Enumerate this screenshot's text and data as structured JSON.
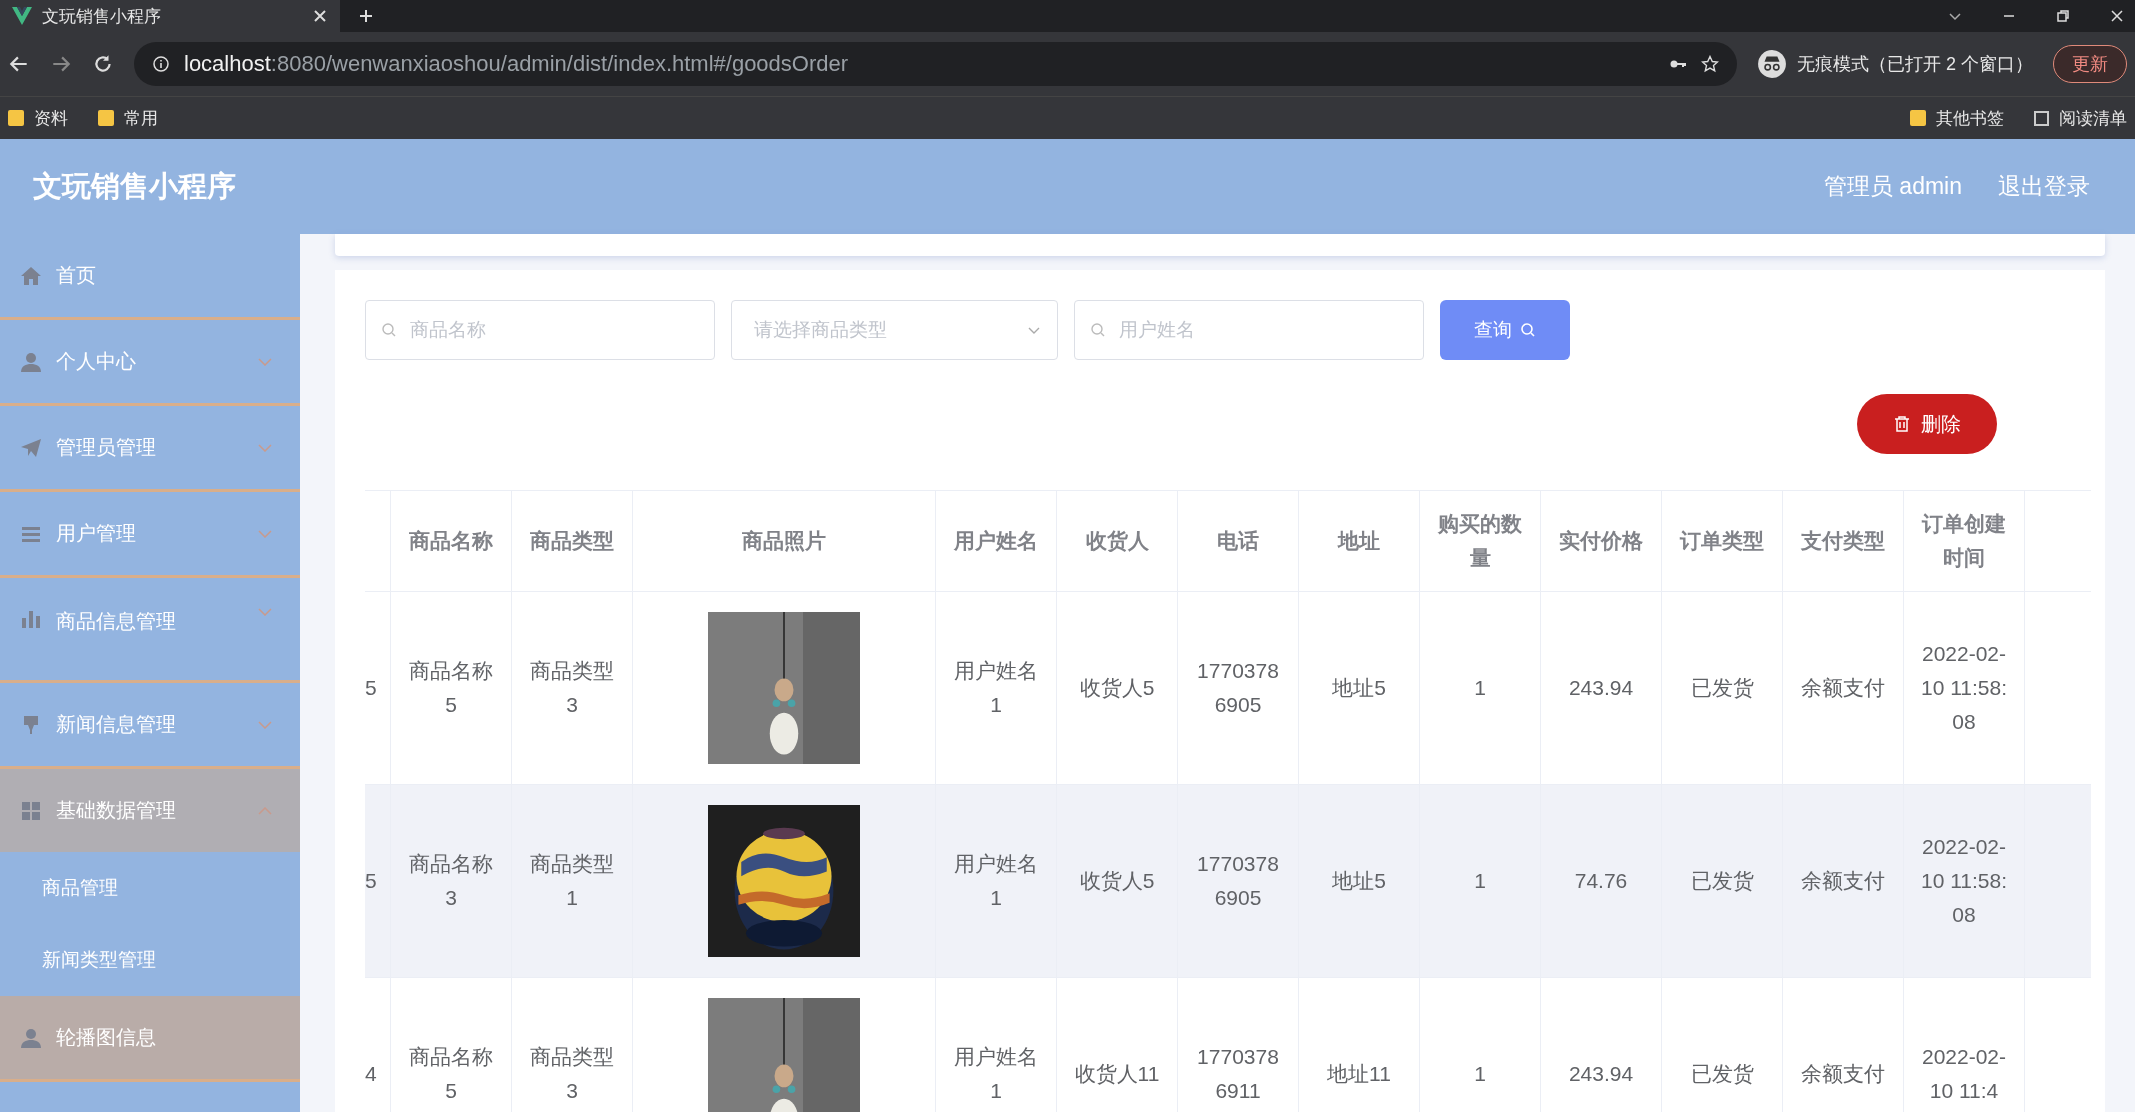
{
  "browser": {
    "tab_title": "文玩销售小程序",
    "url": "**localhost**:8080/wenwanxiaoshou/admin/dist/index.html#/goodsOrder",
    "incognito_label": "无痕模式（已打开 2 个窗口）",
    "update_button": "更新",
    "bookmarks": [
      "资料",
      "常用"
    ],
    "other_bookmarks": "其他书签",
    "reading_list": "阅读清单"
  },
  "header": {
    "title": "文玩销售小程序",
    "user": "管理员 admin",
    "logout": "退出登录"
  },
  "sidebar": {
    "items": [
      {
        "label": "首页",
        "has_arrow": false,
        "expanded": false,
        "highlighted": false
      },
      {
        "label": "个人中心",
        "has_arrow": true,
        "expanded": false,
        "highlighted": false
      },
      {
        "label": "管理员管理",
        "has_arrow": true,
        "expanded": false,
        "highlighted": false
      },
      {
        "label": "用户管理",
        "has_arrow": true,
        "expanded": false,
        "highlighted": false
      },
      {
        "label": "商品信息管理",
        "has_arrow": true,
        "expanded": false,
        "highlighted": false
      },
      {
        "label": "新闻信息管理",
        "has_arrow": true,
        "expanded": false,
        "highlighted": false
      },
      {
        "label": "基础数据管理",
        "has_arrow": true,
        "expanded": true,
        "highlighted": false,
        "children": [
          {
            "label": "商品管理"
          },
          {
            "label": "新闻类型管理"
          }
        ]
      },
      {
        "label": "轮播图信息",
        "has_arrow": false,
        "expanded": false,
        "highlighted": true
      }
    ]
  },
  "filters": {
    "name_placeholder": "商品名称",
    "type_placeholder": "请选择商品类型",
    "user_placeholder": "用户姓名",
    "search_button": "查询"
  },
  "delete_button": "删除",
  "table": {
    "columns": [
      "",
      "商品名称",
      "商品类型",
      "商品照片",
      "用户姓名",
      "收货人",
      "电话",
      "地址",
      "购买的数量",
      "实付价格",
      "订单类型",
      "支付类型",
      "订单创建时间"
    ],
    "rows": [
      {
        "highlighted": false,
        "cells": [
          "5",
          "商品名称5",
          "商品类型3",
          {
            "kind": "picture"
          },
          "用户姓名1",
          "收货人5",
          "17703786905",
          "地址5",
          "1",
          "243.94",
          "已发货",
          "余额支付",
          "2022-02-10 11:58:08"
        ]
      },
      {
        "highlighted": true,
        "cells": [
          "5",
          "商品名称3",
          "商品类型1",
          {
            "kind": "picture"
          },
          "用户姓名1",
          "收货人5",
          "17703786905",
          "地址5",
          "1",
          "74.76",
          "已发货",
          "余额支付",
          "2022-02-10 11:58:08"
        ]
      },
      {
        "highlighted": false,
        "cells": [
          "4",
          "商品名称5",
          "商品类型3",
          {
            "kind": "picture"
          },
          "用户姓名1",
          "收货人11",
          "17703786911",
          "地址11",
          "1",
          "243.94",
          "已发货",
          "余额支付",
          "2022-02-10 11:4"
        ]
      }
    ]
  }
}
